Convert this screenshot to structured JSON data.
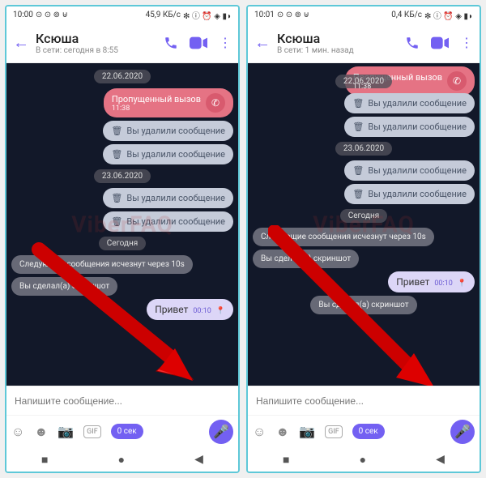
{
  "watermark": "ViberFAQ",
  "screens": [
    {
      "status": {
        "time": "10:00",
        "icons": "⊙ ⊙ ⊚ ⊎",
        "data": "45,9 КБ/с",
        "extras": "✻ ⓘ ⏰ ◈ ▮◗"
      },
      "header": {
        "title": "Ксюша",
        "subtitle": "В сети: сегодня в 8:55"
      },
      "dates": [
        "22.06.2020",
        "23.06.2020",
        "Сегодня"
      ],
      "missed_call": {
        "label": "Пропущенный вызов",
        "time": "11:38"
      },
      "deleted_label": "Вы удалили сообщение",
      "disappear_notice": "Следующие сообщения исчезнут через 10s",
      "screenshot_notice": "Вы сделал(а) скриншот",
      "msg": {
        "text": "Привет",
        "time": "00:10"
      },
      "input_placeholder": "Напишите сообщение...",
      "timer_label": "0 сек"
    },
    {
      "status": {
        "time": "10:01",
        "icons": "⊙ ⊙ ⊚ ⊎",
        "data": "0,4 КБ/с",
        "extras": "✻ ⓘ ⏰ ◈ ▮◗"
      },
      "header": {
        "title": "Ксюша",
        "subtitle": "В сети: 1 мин. назад"
      },
      "dates": [
        "22.06.2020",
        "23.06.2020",
        "Сегодня"
      ],
      "missed_call": {
        "label": "Пропущенный вызов",
        "time": "11:38"
      },
      "deleted_label": "Вы удалили сообщение",
      "disappear_notice": "Следующие сообщения исчезнут через 10s",
      "screenshot_notice": "Вы сделал(а) скриншот",
      "msg": {
        "text": "Привет",
        "time": "00:10"
      },
      "input_placeholder": "Напишите сообщение...",
      "timer_label": "0 сек"
    }
  ]
}
